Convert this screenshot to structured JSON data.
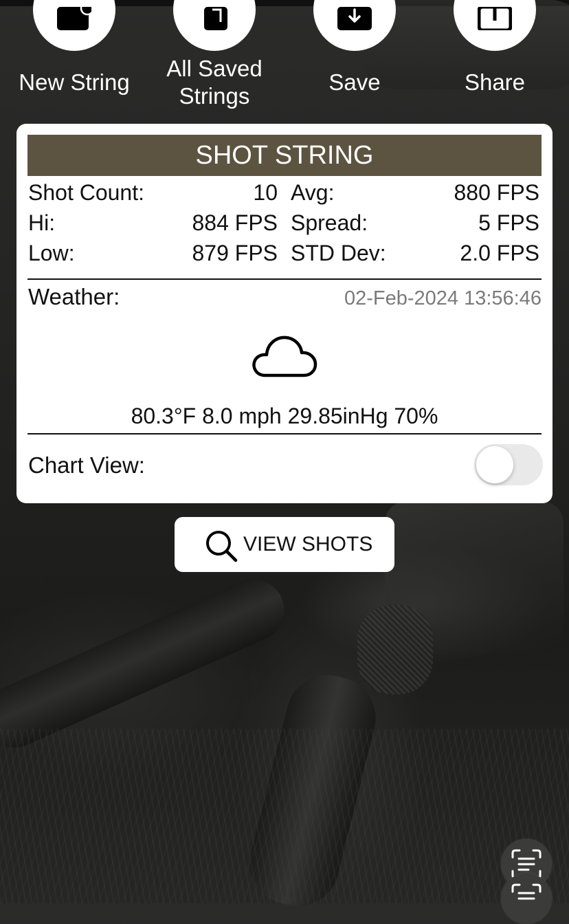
{
  "actions": {
    "new_string": "New String",
    "all_saved_line1": "All Saved",
    "all_saved_line2": "Strings",
    "save": "Save",
    "share": "Share"
  },
  "card": {
    "title": "SHOT STRING",
    "stats": {
      "shot_count_label": "Shot Count:",
      "shot_count_value": "10",
      "avg_label": "Avg:",
      "avg_value": "880 FPS",
      "hi_label": "Hi:",
      "hi_value": "884 FPS",
      "spread_label": "Spread:",
      "spread_value": "5 FPS",
      "low_label": "Low:",
      "low_value": "879 FPS",
      "std_label": "STD Dev:",
      "std_value": "2.0 FPS"
    },
    "weather": {
      "label": "Weather:",
      "timestamp": "02-Feb-2024 13:56:46",
      "icon": "cloud-icon",
      "values": "80.3°F 8.0 mph 29.85inHg 70%"
    },
    "chart_view": {
      "label": "Chart View:",
      "enabled": false
    }
  },
  "view_shots": {
    "label": "VIEW SHOTS",
    "icon": "search-icon"
  },
  "colors": {
    "header_bg": "#5c5341",
    "card_bg": "#ffffff",
    "timestamp": "#7a7a7a"
  }
}
